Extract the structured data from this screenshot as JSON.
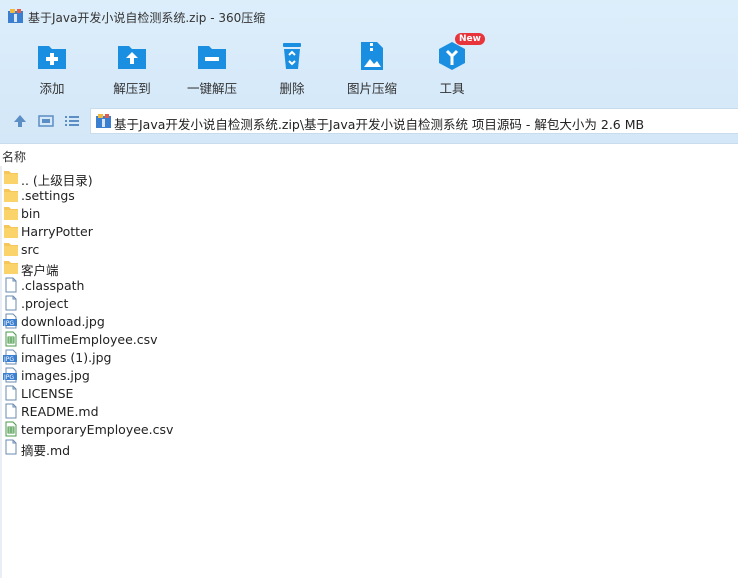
{
  "window": {
    "title": "基于Java开发小说自检测系统.zip - 360压缩"
  },
  "toolbar": {
    "items": [
      {
        "label": "添加",
        "icon": "add-folder-icon"
      },
      {
        "label": "解压到",
        "icon": "extract-to-icon"
      },
      {
        "label": "一键解压",
        "icon": "one-click-extract-icon"
      },
      {
        "label": "删除",
        "icon": "delete-icon"
      },
      {
        "label": "图片压缩",
        "icon": "image-compress-icon"
      },
      {
        "label": "工具",
        "icon": "tools-icon"
      }
    ],
    "new_badge": "New"
  },
  "nav": {
    "path": "基于Java开发小说自检测系统.zip\\基于Java开发小说自检测系统 项目源码 - 解包大小为 2.6 MB"
  },
  "list": {
    "header_name": "名称",
    "files": [
      {
        "name": ".. (上级目录)",
        "type": "folder"
      },
      {
        "name": ".settings",
        "type": "folder"
      },
      {
        "name": "bin",
        "type": "folder"
      },
      {
        "name": "HarryPotter",
        "type": "folder"
      },
      {
        "name": "src",
        "type": "folder"
      },
      {
        "name": "客户端",
        "type": "folder"
      },
      {
        "name": ".classpath",
        "type": "file"
      },
      {
        "name": ".project",
        "type": "file"
      },
      {
        "name": "download.jpg",
        "type": "jpg"
      },
      {
        "name": "fullTimeEmployee.csv",
        "type": "csv"
      },
      {
        "name": "images (1).jpg",
        "type": "jpg"
      },
      {
        "name": "images.jpg",
        "type": "jpg"
      },
      {
        "name": "LICENSE",
        "type": "file"
      },
      {
        "name": "README.md",
        "type": "file"
      },
      {
        "name": "temporaryEmployee.csv",
        "type": "csv"
      },
      {
        "name": "摘要.md",
        "type": "file"
      }
    ]
  },
  "colors": {
    "accent": "#1a8ee0",
    "folder": "#f7c65a",
    "badge": "#e8353b"
  }
}
